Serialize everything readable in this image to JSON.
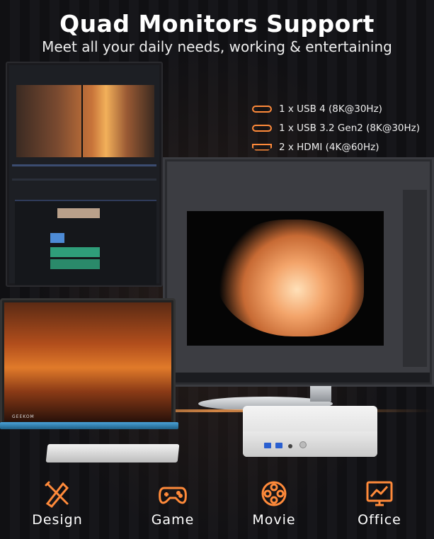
{
  "header": {
    "title": "Quad Monitors Support",
    "subtitle": "Meet all your daily needs, working & entertaining"
  },
  "ports": [
    {
      "icon": "usb-c-icon",
      "label": "1 x USB 4 (8K@30Hz)"
    },
    {
      "icon": "usb-c-icon",
      "label": "1 x USB 3.2 Gen2 (8K@30Hz)"
    },
    {
      "icon": "hdmi-icon",
      "label": "2 x HDMI (4K@60Hz)"
    }
  ],
  "portable_monitor": {
    "brand": "GEEKOM"
  },
  "uses": [
    {
      "icon": "design-tools-icon",
      "label": "Design"
    },
    {
      "icon": "gamepad-icon",
      "label": "Game"
    },
    {
      "icon": "film-reel-icon",
      "label": "Movie"
    },
    {
      "icon": "chart-monitor-icon",
      "label": "Office"
    }
  ],
  "colors": {
    "accent": "#ff8a3a",
    "background": "#0c0c0e",
    "text": "#ffffff"
  }
}
